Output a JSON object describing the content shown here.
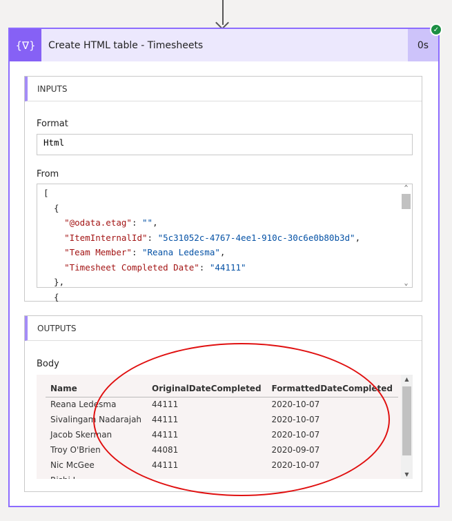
{
  "action": {
    "title": "Create HTML table - Timesheets",
    "duration": "0s",
    "icon": "data-operation-icon",
    "status": "succeeded"
  },
  "inputs": {
    "header": "INPUTS",
    "format_label": "Format",
    "format_value": "Html",
    "from_label": "From",
    "from_lines": [
      [
        {
          "t": "p",
          "v": "["
        }
      ],
      [
        {
          "t": "p",
          "v": "  {"
        }
      ],
      [
        {
          "t": "k",
          "v": "    \"@odata.etag\""
        },
        {
          "t": "p",
          "v": ": "
        },
        {
          "t": "s",
          "v": "\"\""
        },
        {
          "t": "p",
          "v": ","
        }
      ],
      [
        {
          "t": "k",
          "v": "    \"ItemInternalId\""
        },
        {
          "t": "p",
          "v": ": "
        },
        {
          "t": "s",
          "v": "\"5c31052c-4767-4ee1-910c-30c6e0b80b3d\""
        },
        {
          "t": "p",
          "v": ","
        }
      ],
      [
        {
          "t": "k",
          "v": "    \"Team Member\""
        },
        {
          "t": "p",
          "v": ": "
        },
        {
          "t": "s",
          "v": "\"Reana Ledesma\""
        },
        {
          "t": "p",
          "v": ","
        }
      ],
      [
        {
          "t": "k",
          "v": "    \"Timesheet Completed Date\""
        },
        {
          "t": "p",
          "v": ": "
        },
        {
          "t": "s",
          "v": "\"44111\""
        }
      ],
      [
        {
          "t": "p",
          "v": "  },"
        }
      ],
      [
        {
          "t": "p",
          "v": "  {"
        }
      ]
    ]
  },
  "outputs": {
    "header": "OUTPUTS",
    "body_label": "Body",
    "columns": [
      "Name",
      "OriginalDateCompleted",
      "FormattedDateCompleted"
    ],
    "rows": [
      [
        "Reana Ledesma",
        "44111",
        "2020-10-07"
      ],
      [
        "Sivalingam Nadarajah",
        "44111",
        "2020-10-07"
      ],
      [
        "Jacob Skerman",
        "44111",
        "2020-10-07"
      ],
      [
        "Troy O'Brien",
        "44081",
        "2020-09-07"
      ],
      [
        "Nic McGee",
        "44111",
        "2020-10-07"
      ],
      [
        "Rishi L...",
        "",
        ""
      ]
    ]
  },
  "annotation_color": "#e01010"
}
